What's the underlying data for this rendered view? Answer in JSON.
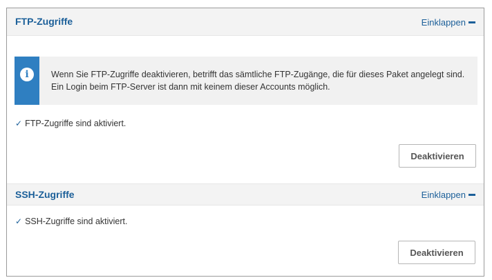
{
  "ftp": {
    "title": "FTP-Zugriffe",
    "collapse_label": "Einklappen",
    "info_text": "Wenn Sie FTP-Zugriffe deaktivieren, betrifft das sämtliche FTP-Zugänge, die für dieses Paket angelegt sind. Ein Login beim FTP-Server ist dann mit keinem dieser Accounts möglich.",
    "info_icon": "info-icon",
    "status_text": "FTP-Zugriffe sind aktiviert.",
    "button_label": "Deaktivieren"
  },
  "ssh": {
    "title": "SSH-Zugriffe",
    "collapse_label": "Einklappen",
    "status_text": "SSH-Zugriffe sind aktiviert.",
    "button_label": "Deaktivieren"
  },
  "colors": {
    "accent": "#1b5f99",
    "info_bar": "#2f7fc1",
    "header_bg": "#f3f3f3"
  }
}
